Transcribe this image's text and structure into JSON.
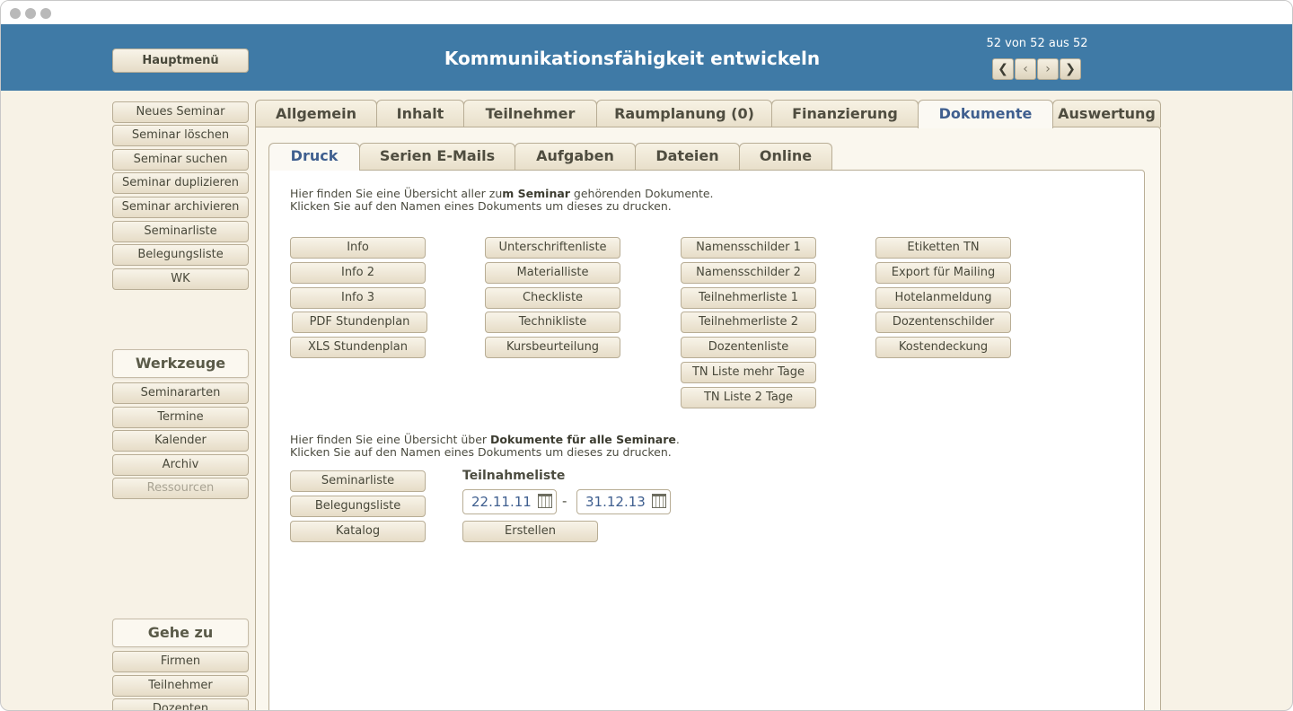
{
  "header": {
    "title": "Kommunikationsfähigkeit entwickeln",
    "main_menu": "Hauptmenü",
    "record_counter": "52 von 52 aus 52",
    "nav": {
      "first": "❮",
      "prev": "‹",
      "next": "›",
      "last": "❯"
    }
  },
  "sidebar": {
    "actions": [
      "Neues Seminar",
      "Seminar löschen",
      "Seminar suchen",
      "Seminar duplizieren",
      "Seminar archivieren",
      "Seminarliste",
      "Belegungsliste",
      "WK"
    ],
    "tools_heading": "Werkzeuge",
    "tools": [
      "Seminararten",
      "Termine",
      "Kalender",
      "Archiv",
      "Ressourcen"
    ],
    "goto_heading": "Gehe zu",
    "goto": [
      "Firmen",
      "Teilnehmer",
      "Dozenten"
    ]
  },
  "tabs": [
    "Allgemein",
    "Inhalt",
    "Teilnehmer",
    "Raumplanung (0)",
    "Finanzierung",
    "Dokumente",
    "Auswertung"
  ],
  "subtabs": [
    "Druck",
    "Serien E-Mails",
    "Aufgaben",
    "Dateien",
    "Online"
  ],
  "intro1": {
    "line1a": "Hier finden Sie eine Übersicht aller zu",
    "line1b": "m Seminar",
    "line1c": " gehörenden Dokumente.",
    "line2": "Klicken Sie auf den Namen eines Dokuments um dieses zu drucken."
  },
  "documents": {
    "col1": [
      "Info",
      "Info 2",
      "Info 3",
      "PDF Stundenplan",
      "XLS Stundenplan"
    ],
    "col2": [
      "Unterschriftenliste",
      "Materialliste",
      "Checkliste",
      "Technikliste",
      "Kursbeurteilung"
    ],
    "col3": [
      "Namensschilder 1",
      "Namensschilder 2",
      "Teilnehmerliste 1",
      "Teilnehmerliste 2",
      "Dozentenliste",
      "TN Liste mehr Tage",
      "TN Liste 2 Tage"
    ],
    "col4": [
      "Etiketten TN",
      "Export für Mailing",
      "Hotelanmeldung",
      "Dozentenschilder",
      "Kostendeckung"
    ]
  },
  "intro2": {
    "line1a": "Hier finden Sie eine Übersicht über ",
    "line1b": "Dokumente für alle Seminare",
    "line1c": ".",
    "line2": "Klicken Sie auf den Namen eines Dokuments um dieses zu drucken."
  },
  "all_docs": [
    "Seminarliste",
    "Belegungsliste",
    "Katalog"
  ],
  "participation": {
    "label": "Teilnahmeliste",
    "date_from": "22.11.11",
    "date_to": "31.12.13",
    "separator": "-",
    "create": "Erstellen"
  },
  "colors": {
    "header": "#3f7aa6",
    "background": "#f7f2e6",
    "active_tab_text": "#3f5f8f"
  }
}
